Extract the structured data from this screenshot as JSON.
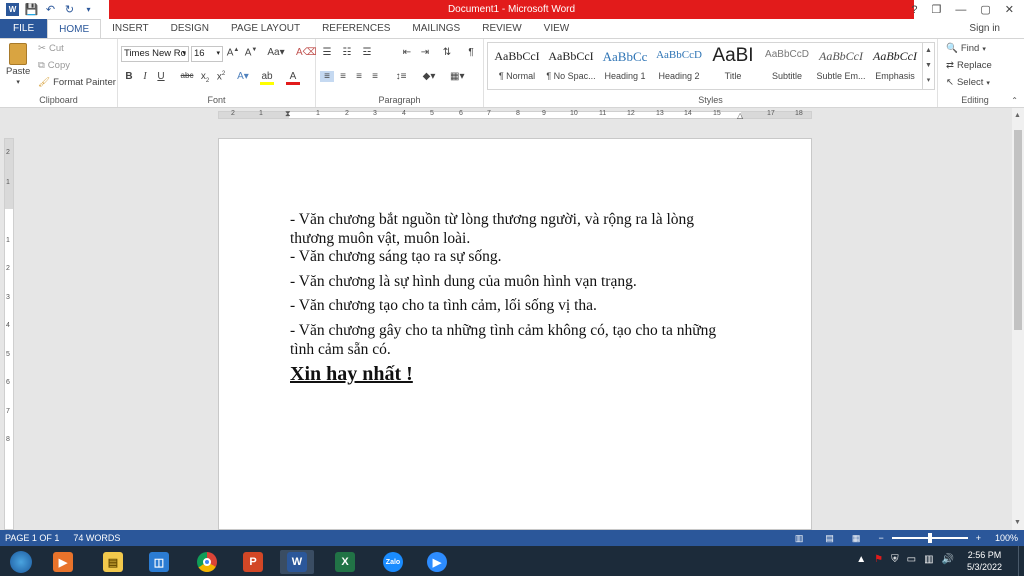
{
  "window": {
    "title": "Document1 - Microsoft Word"
  },
  "titlebar": {
    "help": "?",
    "restore": "❐",
    "minimize": "—",
    "maximize": "▢",
    "close": "✕"
  },
  "tabs": [
    "FILE",
    "HOME",
    "INSERT",
    "DESIGN",
    "PAGE LAYOUT",
    "REFERENCES",
    "MAILINGS",
    "REVIEW",
    "VIEW"
  ],
  "active_tab": "HOME",
  "signin": "Sign in",
  "clipboard": {
    "paste": "Paste",
    "cut": "Cut",
    "copy": "Copy",
    "format_painter": "Format Painter",
    "label": "Clipboard"
  },
  "font": {
    "name": "Times New Ro",
    "size": "16",
    "label": "Font"
  },
  "paragraph": {
    "label": "Paragraph"
  },
  "styles": {
    "label": "Styles",
    "items": [
      {
        "preview": "AaBbCcI",
        "name": "¶ Normal"
      },
      {
        "preview": "AaBbCcI",
        "name": "¶ No Spac..."
      },
      {
        "preview": "AaBbCc",
        "name": "Heading 1"
      },
      {
        "preview": "AaBbCcD",
        "name": "Heading 2"
      },
      {
        "preview": "AaBI",
        "name": "Title"
      },
      {
        "preview": "AaBbCcD",
        "name": "Subtitle"
      },
      {
        "preview": "AaBbCcI",
        "name": "Subtle Em..."
      },
      {
        "preview": "AaBbCcI",
        "name": "Emphasis"
      }
    ]
  },
  "editing": {
    "find": "Find",
    "replace": "Replace",
    "select": "Select",
    "label": "Editing"
  },
  "ruler": {
    "h": [
      "2",
      "1",
      "1",
      "2",
      "3",
      "4",
      "5",
      "6",
      "7",
      "8",
      "9",
      "10",
      "11",
      "12",
      "13",
      "14",
      "15",
      "16",
      "17",
      "18"
    ],
    "v": [
      "2",
      "1",
      "1",
      "2",
      "3",
      "4",
      "5",
      "6",
      "7",
      "8"
    ]
  },
  "document": {
    "lines": [
      "- Văn chương bắt nguồn từ lòng thương người, và rộng ra là lòng",
      "thương muôn vật, muôn loài.",
      "- Văn chương sáng tạo ra sự sống.",
      "- Văn chương là sự hình dung của muôn hình vạn trạng.",
      "- Văn chương tạo cho ta tình cảm, lối sống vị tha.",
      "- Văn chương gây cho ta những tình cảm không có, tạo cho ta những",
      "tình cảm sẵn có."
    ],
    "title": "Xin hay nhất !"
  },
  "status": {
    "page": "PAGE 1 OF 1",
    "words": "74 WORDS",
    "zoom": "100%"
  },
  "clock": {
    "time": "2:56 PM",
    "date": "5/3/2022"
  },
  "taskbar": [
    {
      "name": "media",
      "color": "#e8732b",
      "glyph": "▶"
    },
    {
      "name": "explorer",
      "color": "#f2c94c",
      "glyph": "▤"
    },
    {
      "name": "store",
      "color": "#2b7cd3",
      "glyph": "◫"
    },
    {
      "name": "chrome",
      "color": "#3aa757",
      "glyph": "◉"
    },
    {
      "name": "powerpoint",
      "color": "#d24726",
      "glyph": "P"
    },
    {
      "name": "word",
      "color": "#2b579a",
      "glyph": "W"
    },
    {
      "name": "excel",
      "color": "#217346",
      "glyph": "X"
    },
    {
      "name": "zalo",
      "color": "#1a8cff",
      "glyph": "Zalo"
    },
    {
      "name": "zoom",
      "color": "#2d8cff",
      "glyph": "▶"
    }
  ]
}
